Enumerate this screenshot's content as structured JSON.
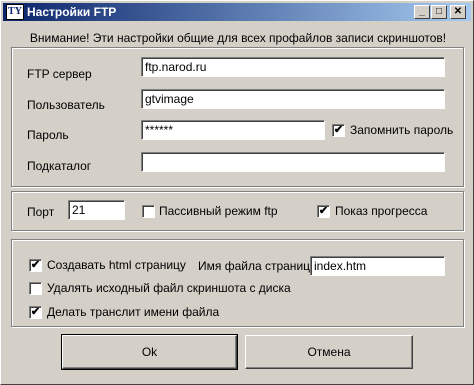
{
  "window": {
    "icon_text": "TY",
    "title": "Настройки FTP"
  },
  "notice": "Внимание! Эти настройки общие для всех профайлов записи скриншотов!",
  "server_group": {
    "server_label": "FTP сервер",
    "server_value": "ftp.narod.ru",
    "user_label": "Пользователь",
    "user_value": "gtvimage",
    "password_label": "Пароль",
    "password_value": "******",
    "remember_label": "Запомнить пароль",
    "remember_checked": true,
    "subdir_label": "Подкаталог",
    "subdir_value": ""
  },
  "port_group": {
    "port_label": "Порт",
    "port_value": "21",
    "passive_label": "Пассивный режим ftp",
    "passive_checked": false,
    "progress_label": "Показ прогресса",
    "progress_checked": true
  },
  "options_group": {
    "create_html_label": "Создавать html страницу",
    "create_html_checked": true,
    "page_file_label": "Имя файла страницы",
    "page_file_value": "index.htm",
    "delete_source_label": "Удалять исходный файл скриншота с диска",
    "delete_source_checked": false,
    "translit_label": "Делать транслит имени файла",
    "translit_checked": true
  },
  "buttons": {
    "ok": "Ok",
    "cancel": "Отмена"
  },
  "check_mark": "✔"
}
